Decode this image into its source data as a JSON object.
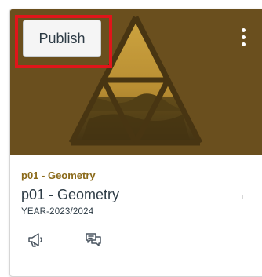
{
  "card": {
    "publish_label": "Publish",
    "menu_icon": "kebab-menu-icon",
    "course_code": "p01 - Geometry",
    "course_name": "p01 - Geometry",
    "term": "YEAR-2023/2024",
    "icons": {
      "announcements": "megaphone-icon",
      "discussions": "discussion-icon"
    }
  },
  "colors": {
    "hero_overlay": "#6f5424",
    "course_code": "#8b6a1a",
    "highlight": "#e0151a",
    "text": "#2d3b45"
  }
}
